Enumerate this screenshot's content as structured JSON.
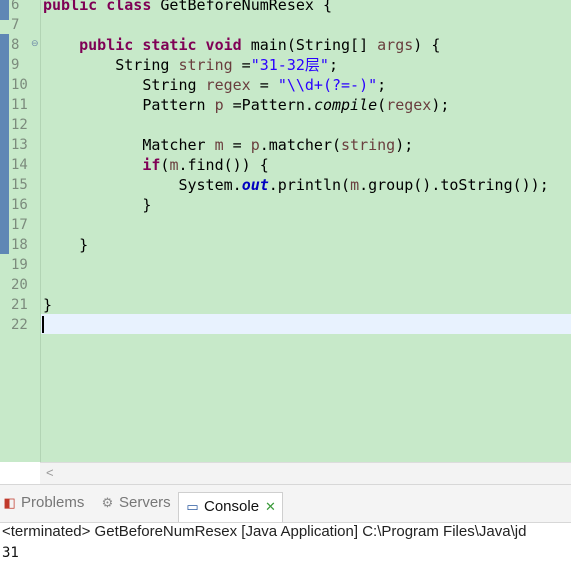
{
  "editor": {
    "line_numbers": [
      "6",
      "7",
      "8",
      "9",
      "10",
      "11",
      "12",
      "13",
      "14",
      "15",
      "16",
      "17",
      "18",
      "19",
      "20",
      "21",
      "22"
    ],
    "code": {
      "l6_kw": "public class",
      "l6_text": " GetBeforeNumResex {",
      "l8_kw": "public static void",
      "l8_text": " main(String[] ",
      "l8_args": "args",
      "l8_end": ") {",
      "l9_type": "String ",
      "l9_var": "string",
      "l9_eq": " =",
      "l9_str": "\"31-32层\"",
      "l9_end": ";",
      "l10_type": "String ",
      "l10_var": "regex",
      "l10_eq": " = ",
      "l10_str": "\"\\\\d+(?=-)\"",
      "l10_end": ";",
      "l11_type": "Pattern ",
      "l11_var": "p",
      "l11_eq": " =Pattern.",
      "l11_method": "compile",
      "l11_open": "(",
      "l11_arg": "regex",
      "l11_end": ");",
      "l13_type": "Matcher ",
      "l13_var": "m",
      "l13_eq": " = ",
      "l13_p": "p",
      "l13_call": ".matcher(",
      "l13_arg": "string",
      "l13_end": ");",
      "l14_kw": "if",
      "l14_open": "(",
      "l14_m": "m",
      "l14_end": ".find()) {",
      "l15_sys": "System.",
      "l15_out": "out",
      "l15_call": ".println(",
      "l15_m": "m",
      "l15_end": ".group().toString());",
      "l16": "}",
      "l18": "}",
      "l21": "}"
    }
  },
  "views": {
    "tabs": [
      {
        "label": "Problems",
        "icon": "problems-icon"
      },
      {
        "label": "Servers",
        "icon": "servers-icon"
      },
      {
        "label": "Console",
        "icon": "console-icon",
        "active": true
      }
    ],
    "close_glyph": "✕",
    "status": "<terminated> GetBeforeNumResex [Java Application] C:\\Program Files\\Java\\jd",
    "output": "31"
  }
}
